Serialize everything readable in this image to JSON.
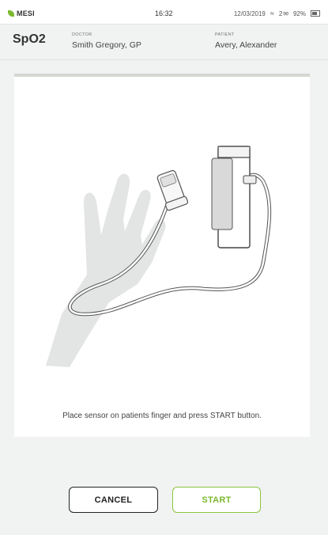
{
  "statusbar": {
    "brand": "MESI",
    "time": "16:32",
    "date": "12/03/2019",
    "mail_count": "2",
    "battery": "92%"
  },
  "header": {
    "title": "SpO2",
    "doctor_label": "DOCTOR",
    "doctor_value": "Smith Gregory, GP",
    "patient_label": "PATIENT",
    "patient_value": "Avery, Alexander"
  },
  "panel": {
    "instruction": "Place sensor on patients finger and press START button."
  },
  "buttons": {
    "cancel_label": "CANCEL",
    "start_label": "START"
  },
  "colors": {
    "accent": "#7bb92f",
    "background": "#f1f2f2"
  }
}
